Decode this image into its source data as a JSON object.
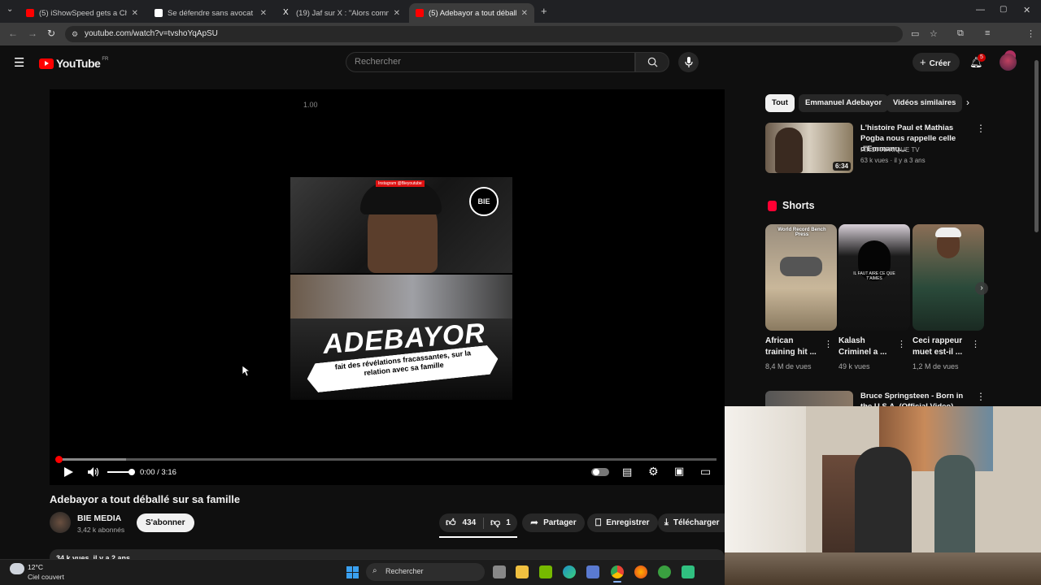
{
  "browser": {
    "tabs": [
      {
        "title": "(5) iShowSpeed gets a Chinese"
      },
      {
        "title": "Se défendre sans avocat - Pierr"
      },
      {
        "title": "(19) Jaf sur X : \"Alors comment"
      },
      {
        "title": "(5) Adebayor a tout déballé sur"
      }
    ],
    "url": "youtube.com/watch?v=tvshoYqApSU"
  },
  "header": {
    "logo_text": "YouTube",
    "region": "FR",
    "search_placeholder": "Rechercher",
    "create_label": "Créer",
    "notif_count": "5"
  },
  "player": {
    "speed_label": "1.00",
    "thumb_banner": "Instagram @Bieyoutube",
    "thumb_badge": "BIE",
    "thumb_headline": "ADEBAYOR",
    "thumb_subtitle": "fait des révélations fracassantes, sur la relation avec sa famille",
    "time": "0:00 / 3:16"
  },
  "video": {
    "title": "Adebayor a tout déballé sur sa famille",
    "channel": "BIE MEDIA",
    "subscribers": "3,42 k abonnés",
    "subscribe_label": "S'abonner",
    "likes": "434",
    "dislikes": "1",
    "share_label": "Partager",
    "save_label": "Enregistrer",
    "download_label": "Télécharger",
    "meta": "34 k vues  il y a 2 ans"
  },
  "sidebar": {
    "chips": [
      "Tout",
      "Emmanuel Adebayor",
      "Vidéos similaires"
    ],
    "rec1": {
      "title": "L'histoire Paul et Mathias Pogba nous rappelle celle d'Emmanu...",
      "channel": "FIRST AFRIQUE TV",
      "stats": "63 k vues · il y a 3 ans",
      "duration": "6:34"
    },
    "shorts_title": "Shorts",
    "shorts": [
      {
        "title": "African training hit ...",
        "views": "8,4 M de vues",
        "overlay": "World Record Bench Press"
      },
      {
        "title": "Kalash Criminel a ...",
        "views": "49 k vues",
        "overlay": "IL FAUT AIRE CE QUE T'AIMES"
      },
      {
        "title": "Ceci rappeur muet est-il ...",
        "views": "1,2 M de vues",
        "overlay": ""
      }
    ],
    "rec2": {
      "title": "Bruce Springsteen - Born in the U.S.A. (Official Video)"
    }
  },
  "taskbar": {
    "temp": "12°C",
    "weather": "Ciel couvert",
    "search_placeholder": "Rechercher"
  },
  "colors": {
    "bg": "#0f0f0f",
    "accent_red": "#ff0000",
    "chip_bg": "#272727"
  }
}
